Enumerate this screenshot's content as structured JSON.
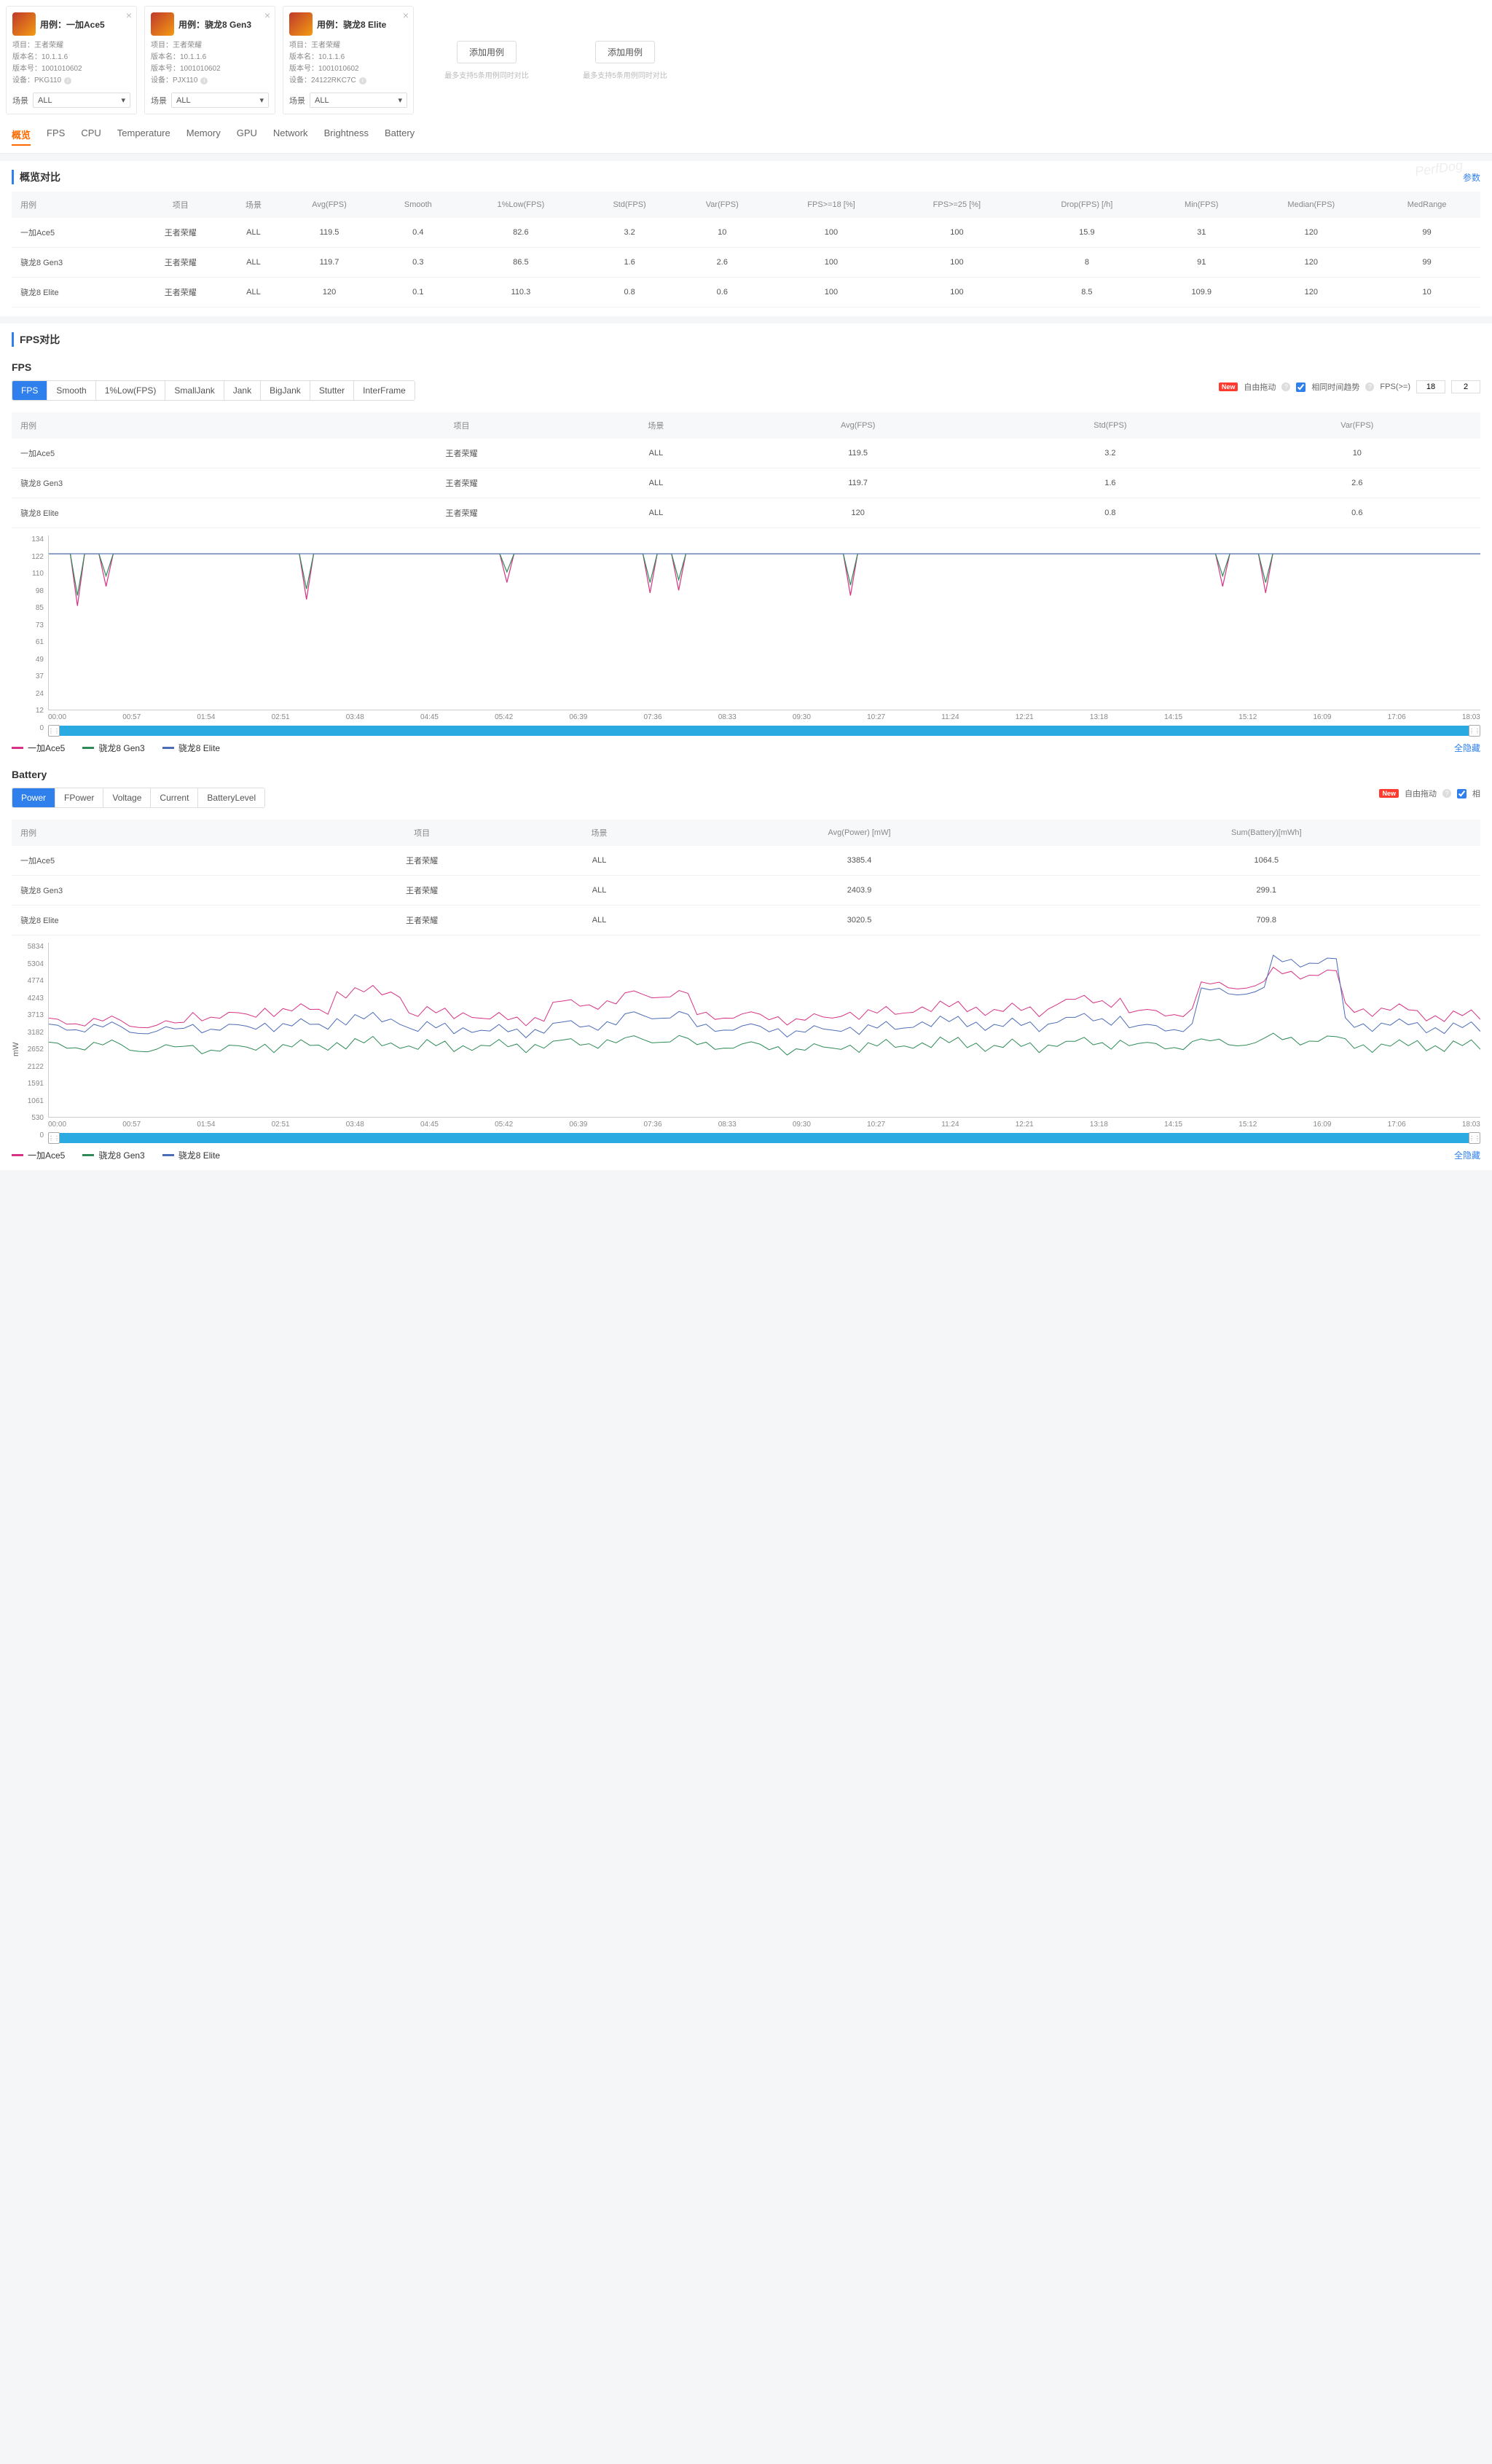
{
  "cards": [
    {
      "title": "用例：一加Ace5",
      "project_label": "项目：",
      "project": "王者荣耀",
      "version_label": "版本名：",
      "version": "10.1.1.6",
      "build_label": "版本号：",
      "build": "1001010602",
      "device_label": "设备：",
      "device": "PKG110",
      "scene_label": "场景",
      "scene_value": "ALL"
    },
    {
      "title": "用例：骁龙8 Gen3",
      "project_label": "项目：",
      "project": "王者荣耀",
      "version_label": "版本名：",
      "version": "10.1.1.6",
      "build_label": "版本号：",
      "build": "1001010602",
      "device_label": "设备：",
      "device": "PJX110",
      "scene_label": "场景",
      "scene_value": "ALL"
    },
    {
      "title": "用例：骁龙8 Elite",
      "project_label": "项目：",
      "project": "王者荣耀",
      "version_label": "版本名：",
      "version": "10.1.1.6",
      "build_label": "版本号：",
      "build": "1001010602",
      "device_label": "设备：",
      "device": "24122RKC7C",
      "scene_label": "场景",
      "scene_value": "ALL"
    }
  ],
  "add_card": {
    "btn": "添加用例",
    "hint": "最多支持5条用例同时对比"
  },
  "nav_tabs": [
    "概览",
    "FPS",
    "CPU",
    "Temperature",
    "Memory",
    "GPU",
    "Network",
    "Brightness",
    "Battery"
  ],
  "overview": {
    "title": "概览对比",
    "params": "参数",
    "headers": [
      "用例",
      "项目",
      "场景",
      "Avg(FPS)",
      "Smooth",
      "1%Low(FPS)",
      "Std(FPS)",
      "Var(FPS)",
      "FPS>=18 [%]",
      "FPS>=25 [%]",
      "Drop(FPS) [/h]",
      "Min(FPS)",
      "Median(FPS)",
      "MedRange"
    ],
    "rows": [
      [
        "一加Ace5",
        "王者荣耀",
        "ALL",
        "119.5",
        "0.4",
        "82.6",
        "3.2",
        "10",
        "100",
        "100",
        "15.9",
        "31",
        "120",
        "99"
      ],
      [
        "骁龙8 Gen3",
        "王者荣耀",
        "ALL",
        "119.7",
        "0.3",
        "86.5",
        "1.6",
        "2.6",
        "100",
        "100",
        "8",
        "91",
        "120",
        "99"
      ],
      [
        "骁龙8 Elite",
        "王者荣耀",
        "ALL",
        "120",
        "0.1",
        "110.3",
        "0.8",
        "0.6",
        "100",
        "100",
        "8.5",
        "109.9",
        "120",
        "10"
      ]
    ]
  },
  "fps_section": {
    "title": "FPS对比",
    "sub": "FPS",
    "pills": [
      "FPS",
      "Smooth",
      "1%Low(FPS)",
      "SmallJank",
      "Jank",
      "BigJank",
      "Stutter",
      "InterFrame"
    ],
    "toolbar": {
      "new": "New",
      "free": "自由拖动",
      "trend": "相同时间趋势",
      "thresh_label": "FPS(>=)",
      "thresh": "18",
      "thresh2": "2"
    },
    "table": {
      "headers": [
        "用例",
        "项目",
        "场景",
        "Avg(FPS)",
        "Std(FPS)",
        "Var(FPS)"
      ],
      "rows": [
        [
          "一加Ace5",
          "王者荣耀",
          "ALL",
          "119.5",
          "3.2",
          "10"
        ],
        [
          "骁龙8 Gen3",
          "王者荣耀",
          "ALL",
          "119.7",
          "1.6",
          "2.6"
        ],
        [
          "骁龙8 Elite",
          "王者荣耀",
          "ALL",
          "120",
          "0.8",
          "0.6"
        ]
      ]
    },
    "y_ticks": [
      "134",
      "122",
      "110",
      "98",
      "85",
      "73",
      "61",
      "49",
      "37",
      "24",
      "12",
      "0"
    ],
    "x_ticks": [
      "00:00",
      "00:57",
      "01:54",
      "02:51",
      "03:48",
      "04:45",
      "05:42",
      "06:39",
      "07:36",
      "08:33",
      "09:30",
      "10:27",
      "11:24",
      "12:21",
      "13:18",
      "14:15",
      "15:12",
      "16:09",
      "17:06",
      "18:03"
    ],
    "legend": [
      "一加Ace5",
      "骁龙8 Gen3",
      "骁龙8 Elite"
    ],
    "hide_all": "全隐藏"
  },
  "battery_section": {
    "sub": "Battery",
    "pills": [
      "Power",
      "FPower",
      "Voltage",
      "Current",
      "BatteryLevel"
    ],
    "toolbar": {
      "new": "New",
      "free": "自由拖动",
      "trend": "相"
    },
    "table": {
      "headers": [
        "用例",
        "项目",
        "场景",
        "Avg(Power) [mW]",
        "Sum(Battery)[mWh]"
      ],
      "rows": [
        [
          "一加Ace5",
          "王者荣耀",
          "ALL",
          "3385.4",
          "1064.5"
        ],
        [
          "骁龙8 Gen3",
          "王者荣耀",
          "ALL",
          "2403.9",
          "299.1"
        ],
        [
          "骁龙8 Elite",
          "王者荣耀",
          "ALL",
          "3020.5",
          "709.8"
        ]
      ]
    },
    "y_label": "mW",
    "y_ticks": [
      "5834",
      "5304",
      "4774",
      "4243",
      "3713",
      "3182",
      "2652",
      "2122",
      "1591",
      "1061",
      "530",
      "0"
    ],
    "x_ticks": [
      "00:00",
      "00:57",
      "01:54",
      "02:51",
      "03:48",
      "04:45",
      "05:42",
      "06:39",
      "07:36",
      "08:33",
      "09:30",
      "10:27",
      "11:24",
      "12:21",
      "13:18",
      "14:15",
      "15:12",
      "16:09",
      "17:06",
      "18:03"
    ],
    "legend": [
      "一加Ace5",
      "骁龙8 Gen3",
      "骁龙8 Elite"
    ],
    "hide_all": "全隐藏"
  },
  "chart_data": [
    {
      "type": "line",
      "title": "FPS",
      "ylabel": "",
      "ylim": [
        0,
        134
      ],
      "x": [
        "00:00",
        "00:57",
        "01:54",
        "02:51",
        "03:48",
        "04:45",
        "05:42",
        "06:39",
        "07:36",
        "08:33",
        "09:30",
        "10:27",
        "11:24",
        "12:21",
        "13:18",
        "14:15",
        "15:12",
        "16:09",
        "17:06",
        "18:03"
      ],
      "series": [
        {
          "name": "一加Ace5",
          "color": "#d63384",
          "avg": 119.5,
          "std": 3.2,
          "note": "flat ~120 with occasional drops to ~80-100"
        },
        {
          "name": "骁龙8 Gen3",
          "color": "#2e8b57",
          "avg": 119.7,
          "std": 1.6,
          "note": "flat ~120 with rare small drops"
        },
        {
          "name": "骁龙8 Elite",
          "color": "#4b6cb7",
          "avg": 120,
          "std": 0.8,
          "note": "flat ~120, nearly no drops"
        }
      ]
    },
    {
      "type": "line",
      "title": "Power",
      "ylabel": "mW",
      "ylim": [
        0,
        5834
      ],
      "x": [
        "00:00",
        "00:57",
        "01:54",
        "02:51",
        "03:48",
        "04:45",
        "05:42",
        "06:39",
        "07:36",
        "08:33",
        "09:30",
        "10:27",
        "11:24",
        "12:21",
        "13:18",
        "14:15",
        "15:12",
        "16:09",
        "17:06",
        "18:03"
      ],
      "series": [
        {
          "name": "一加Ace5",
          "color": "#d63384",
          "avg": 3385.4,
          "values": [
            3200,
            3100,
            3400,
            3600,
            4200,
            3500,
            3300,
            3800,
            4100,
            3400,
            3300,
            3500,
            3700,
            3600,
            3900,
            3500,
            4400,
            4800,
            3600,
            3400
          ]
        },
        {
          "name": "骁龙8 Gen3",
          "color": "#2e8b57",
          "avg": 2403.9,
          "values": [
            2400,
            2300,
            2300,
            2400,
            2500,
            2400,
            2400,
            2500,
            2600,
            2400,
            2300,
            2400,
            2500,
            2400,
            2500,
            2400,
            2500,
            2600,
            2400,
            2400
          ]
        },
        {
          "name": "骁龙8 Elite",
          "color": "#4b6cb7",
          "avg": 3020.5,
          "values": [
            3000,
            2900,
            3000,
            3100,
            3300,
            3000,
            2900,
            3100,
            3400,
            3000,
            2900,
            3000,
            3200,
            3100,
            3300,
            3000,
            4200,
            5200,
            3100,
            3000
          ]
        }
      ]
    }
  ],
  "colors": {
    "s0": "#d63384",
    "s1": "#2e8b57",
    "s2": "#4b6cb7"
  }
}
